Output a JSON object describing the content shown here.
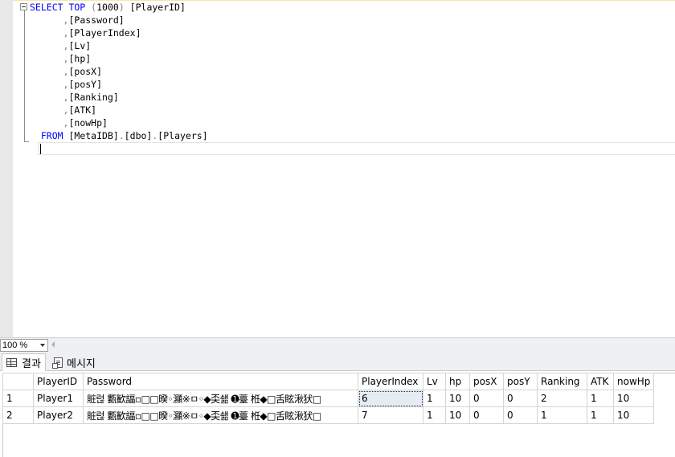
{
  "editor": {
    "lines": [
      {
        "indent": "",
        "tokens": [
          {
            "t": "SELECT TOP ",
            "c": "kw"
          },
          {
            "t": "(",
            "c": "gr"
          },
          {
            "t": "1000",
            "c": "bk"
          },
          {
            "t": ")",
            "c": "gr"
          },
          {
            "t": " [PlayerID]",
            "c": "bk"
          }
        ]
      },
      {
        "indent": "      ",
        "tokens": [
          {
            "t": ",",
            "c": "gr"
          },
          {
            "t": "[Password]",
            "c": "bk"
          }
        ]
      },
      {
        "indent": "      ",
        "tokens": [
          {
            "t": ",",
            "c": "gr"
          },
          {
            "t": "[PlayerIndex]",
            "c": "bk"
          }
        ]
      },
      {
        "indent": "      ",
        "tokens": [
          {
            "t": ",",
            "c": "gr"
          },
          {
            "t": "[Lv]",
            "c": "bk"
          }
        ]
      },
      {
        "indent": "      ",
        "tokens": [
          {
            "t": ",",
            "c": "gr"
          },
          {
            "t": "[hp]",
            "c": "bk"
          }
        ]
      },
      {
        "indent": "      ",
        "tokens": [
          {
            "t": ",",
            "c": "gr"
          },
          {
            "t": "[posX]",
            "c": "bk"
          }
        ]
      },
      {
        "indent": "      ",
        "tokens": [
          {
            "t": ",",
            "c": "gr"
          },
          {
            "t": "[posY]",
            "c": "bk"
          }
        ]
      },
      {
        "indent": "      ",
        "tokens": [
          {
            "t": ",",
            "c": "gr"
          },
          {
            "t": "[Ranking]",
            "c": "bk"
          }
        ]
      },
      {
        "indent": "      ",
        "tokens": [
          {
            "t": ",",
            "c": "gr"
          },
          {
            "t": "[ATK]",
            "c": "bk"
          }
        ]
      },
      {
        "indent": "      ",
        "tokens": [
          {
            "t": ",",
            "c": "gr"
          },
          {
            "t": "[nowHp]",
            "c": "bk"
          }
        ]
      },
      {
        "indent": "  ",
        "tokens": [
          {
            "t": "FROM ",
            "c": "kw"
          },
          {
            "t": "[MetaIDB]",
            "c": "bk"
          },
          {
            "t": ".",
            "c": "gr"
          },
          {
            "t": "[dbo]",
            "c": "bk"
          },
          {
            "t": ".",
            "c": "gr"
          },
          {
            "t": "[Players]",
            "c": "bk"
          }
        ]
      }
    ]
  },
  "zoom": {
    "value": "100 %"
  },
  "tabs": {
    "results_label": "결과",
    "messages_label": "메시지"
  },
  "grid": {
    "columns": [
      "",
      "PlayerID",
      "Password",
      "PlayerIndex",
      "Lv",
      "hp",
      "posX",
      "posY",
      "Ranking",
      "ATK",
      "nowHp"
    ],
    "rows": [
      [
        "1",
        "Player1",
        "賍럲   甊歓諨▫□□暌◦灦※ㅁ◦◆奀쇎    ➊薹    栣◆□舌眩湫犾□",
        "6",
        "1",
        "10",
        "0",
        "0",
        "2",
        "1",
        "10"
      ],
      [
        "2",
        "Player2",
        "賍럲   甊歓諨▫□□暌◦灦※ㅁ◦◆奀쇎    ➊薹    栣◆□舌眩湫犾□",
        "7",
        "1",
        "10",
        "0",
        "0",
        "1",
        "1",
        "10"
      ]
    ]
  },
  "colors": {
    "keyword": "#0000ff",
    "punctuation": "#808080",
    "selection": "#e6ecf4"
  }
}
